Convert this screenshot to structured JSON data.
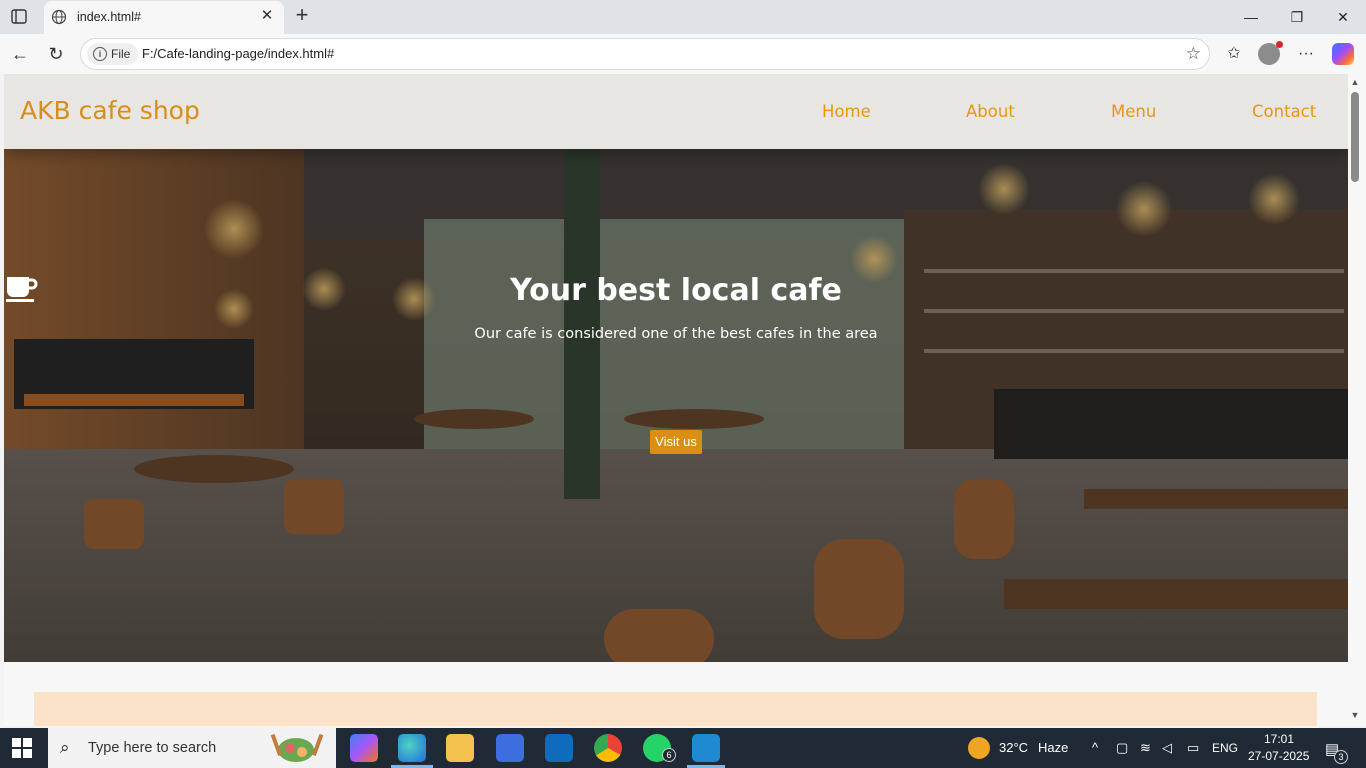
{
  "browser": {
    "tab_title": "index.html#",
    "address_chip": "File",
    "url": "F:/Cafe-landing-page/index.html#"
  },
  "site": {
    "logo": "AKB cafe shop",
    "nav": [
      "Home",
      "About",
      "Menu",
      "Contact"
    ],
    "hero_title": "Your best local cafe",
    "hero_icon": "coffee-cup-icon",
    "hero_subtitle": "Our cafe is considered one of the best cafes in the area",
    "hero_button": "Visit us",
    "accent_color": "#d98e14"
  },
  "taskbar": {
    "search_placeholder": "Type here to search",
    "weather_temp": "32°C",
    "weather_desc": "Haze",
    "language": "ENG",
    "time": "17:01",
    "date": "27-07-2025",
    "whatsapp_badge": "6",
    "notifications_badge": "3"
  }
}
